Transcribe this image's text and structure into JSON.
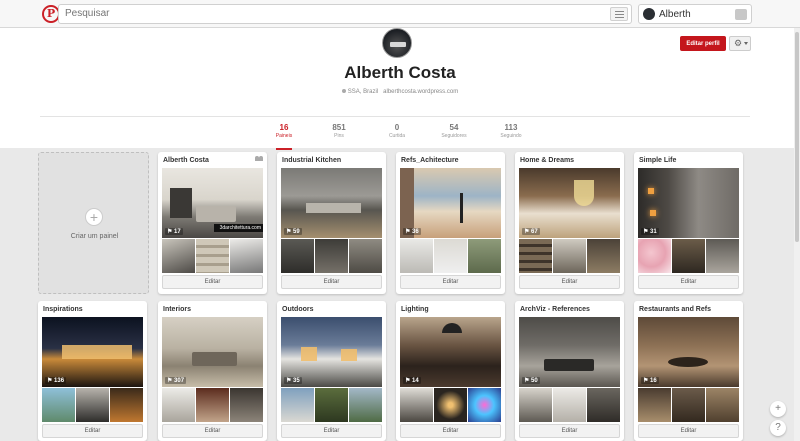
{
  "search": {
    "placeholder": "Pesquisar"
  },
  "user": {
    "name": "Alberth"
  },
  "profile": {
    "name": "Alberth Costa",
    "location": "SSA, Brazil",
    "website": "alberthcosta.wordpress.com",
    "edit_label": "Editar perfil",
    "stats": [
      {
        "num": "16",
        "label": "Paineis"
      },
      {
        "num": "851",
        "label": "Pins"
      },
      {
        "num": "0",
        "label": "Curtida"
      },
      {
        "num": "54",
        "label": "Seguidores"
      },
      {
        "num": "113",
        "label": "Seguindo"
      }
    ]
  },
  "create_board": {
    "label": "Criar um painel"
  },
  "boards": [
    {
      "title": "Alberth Costa",
      "count": "17",
      "edit": "Editar",
      "watermark": "3darchitettura.com"
    },
    {
      "title": "Industrial Kitchen",
      "count": "59",
      "edit": "Editar"
    },
    {
      "title": "Refs_Achitecture",
      "count": "36",
      "edit": "Editar"
    },
    {
      "title": "Home & Dreams",
      "count": "67",
      "edit": "Editar"
    },
    {
      "title": "Simple Life",
      "count": "31",
      "edit": "Editar"
    },
    {
      "title": "Inspirations",
      "count": "136",
      "edit": "Editar"
    },
    {
      "title": "Interiors",
      "count": "307",
      "edit": "Editar"
    },
    {
      "title": "Outdoors",
      "count": "35",
      "edit": "Editar"
    },
    {
      "title": "Lighting",
      "count": "14",
      "edit": "Editar"
    },
    {
      "title": "ArchViz - References",
      "count": "50",
      "edit": "Editar"
    },
    {
      "title": "Restaurants and Refs",
      "count": "16",
      "edit": "Editar"
    }
  ],
  "help": {
    "plus": "+",
    "question": "?"
  },
  "colors": {
    "brand": "#cb2027"
  }
}
